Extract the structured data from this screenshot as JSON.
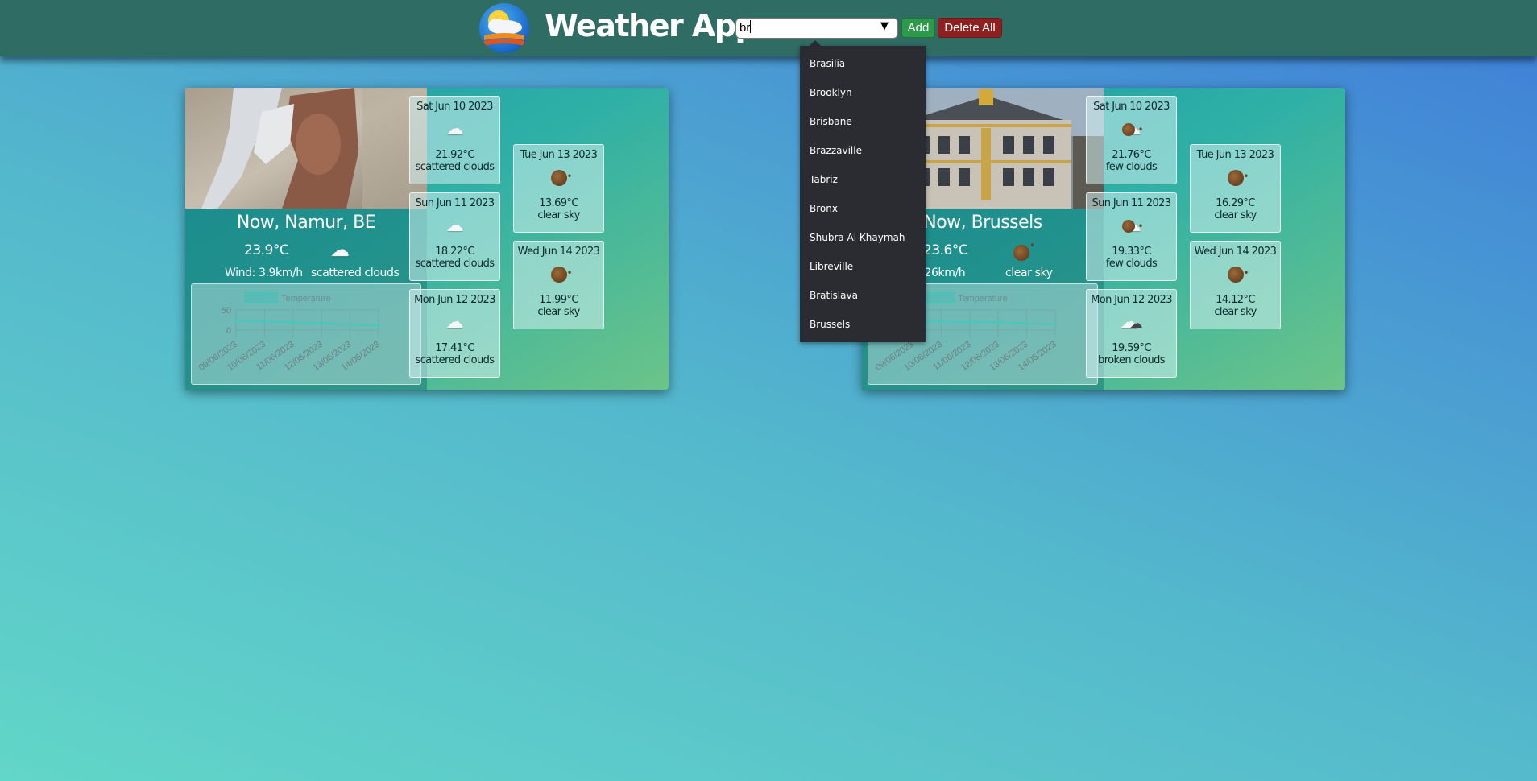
{
  "header": {
    "title": "Weather App",
    "search_value": "br",
    "add_label": "Add",
    "delete_all_label": "Delete All"
  },
  "suggestions": [
    "Brasilia",
    "Brooklyn",
    "Brisbane",
    "Brazzaville",
    "Tabriz",
    "Bronx",
    "Shubra Al Khaymah",
    "Libreville",
    "Bratislava",
    "Brussels"
  ],
  "cards": [
    {
      "title": "Now, Namur, BE",
      "temp": "23.9°C",
      "wind": "Wind: 3.9km/h",
      "desc": "scattered clouds",
      "icon": "cloud-icon",
      "chart_data": {
        "type": "line",
        "legend": "Temperature",
        "x": [
          "09/06/2023",
          "10/06/2023",
          "11/06/2023",
          "12/06/2023",
          "13/06/2023",
          "14/06/2023"
        ],
        "values": [
          23.9,
          21.92,
          18.22,
          17.41,
          13.69,
          11.99
        ],
        "yticks": [
          0,
          50
        ],
        "ylim": [
          -10,
          50
        ]
      },
      "forecast": [
        {
          "date": "Sat Jun 10 2023",
          "temp": "21.92°C",
          "desc": "scattered clouds",
          "icon": "cloud-icon"
        },
        {
          "date": "Sun Jun 11 2023",
          "temp": "18.22°C",
          "desc": "scattered clouds",
          "icon": "cloud-icon"
        },
        {
          "date": "Mon Jun 12 2023",
          "temp": "17.41°C",
          "desc": "scattered clouds",
          "icon": "cloud-icon"
        },
        {
          "date": "Tue Jun 13 2023",
          "temp": "13.69°C",
          "desc": "clear sky",
          "icon": "sun-icon"
        },
        {
          "date": "Wed Jun 14 2023",
          "temp": "11.99°C",
          "desc": "clear sky",
          "icon": "sun-icon"
        }
      ]
    },
    {
      "title": "Now, Brussels",
      "temp": "23.6°C",
      "wind": "Wind: 4.26km/h",
      "desc": "clear sky",
      "icon": "sun-icon",
      "chart_data": {
        "type": "line",
        "legend": "Temperature",
        "x": [
          "09/06/2023",
          "10/06/2023",
          "11/06/2023",
          "12/06/2023",
          "13/06/2023",
          "14/06/2023"
        ],
        "values": [
          23.6,
          21.76,
          19.33,
          19.59,
          16.29,
          14.12
        ],
        "yticks": [
          0,
          50
        ],
        "ylim": [
          -10,
          50
        ]
      },
      "forecast": [
        {
          "date": "Sat Jun 10 2023",
          "temp": "21.76°C",
          "desc": "few clouds",
          "icon": "partly-cloudy-icon"
        },
        {
          "date": "Sun Jun 11 2023",
          "temp": "19.33°C",
          "desc": "few clouds",
          "icon": "partly-cloudy-icon"
        },
        {
          "date": "Mon Jun 12 2023",
          "temp": "19.59°C",
          "desc": "broken clouds",
          "icon": "broken-clouds-icon"
        },
        {
          "date": "Tue Jun 13 2023",
          "temp": "16.29°C",
          "desc": "clear sky",
          "icon": "sun-icon"
        },
        {
          "date": "Wed Jun 14 2023",
          "temp": "14.12°C",
          "desc": "clear sky",
          "icon": "sun-icon"
        }
      ]
    }
  ]
}
